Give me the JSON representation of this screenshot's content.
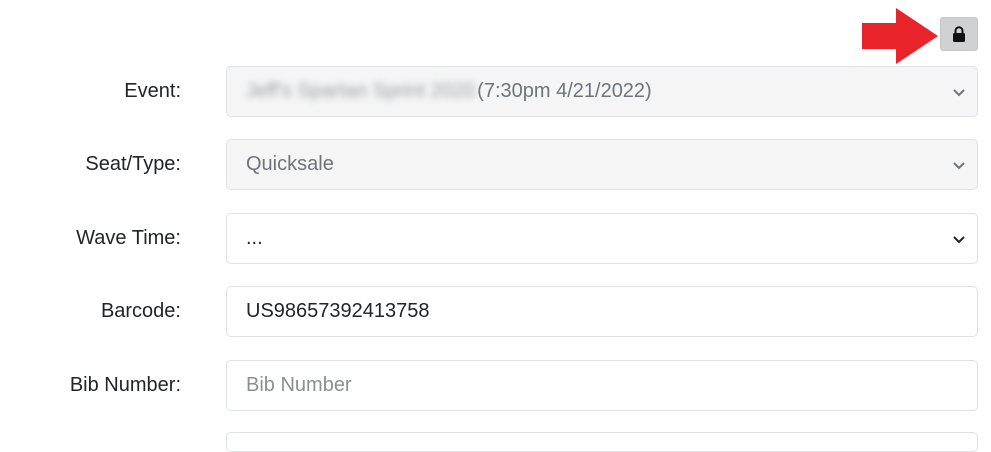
{
  "toolbar": {
    "lock_icon": "lock-icon",
    "arrow_icon": "right-arrow-icon",
    "arrow_color": "#e8232a"
  },
  "form": {
    "event": {
      "label": "Event:",
      "value_blurred": "Jeff's Spartan Sprint 2020",
      "value_suffix": "(7:30pm 4/21/2022)"
    },
    "seat_type": {
      "label": "Seat/Type:",
      "value": "Quicksale"
    },
    "wave_time": {
      "label": "Wave Time:",
      "value": "..."
    },
    "barcode": {
      "label": "Barcode:",
      "value": "US98657392413758"
    },
    "bib_number": {
      "label": "Bib Number:",
      "placeholder": "Bib Number"
    }
  }
}
